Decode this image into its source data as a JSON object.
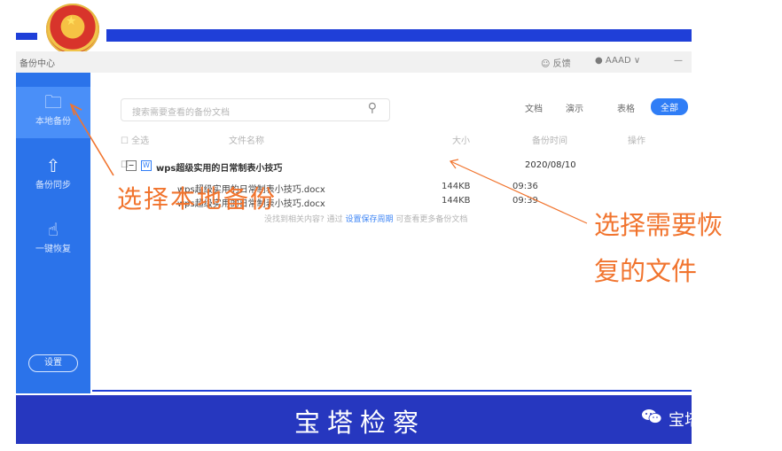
{
  "app": {
    "title": "备份中心",
    "feedback": "反馈",
    "user": "AAAD ∨",
    "minimize": "—"
  },
  "sidebar": {
    "items": [
      {
        "label": "本地备份",
        "icon": "local-backup-icon"
      },
      {
        "label": "备份同步",
        "icon": "cloud-sync-icon"
      },
      {
        "label": "一键恢复",
        "icon": "restore-icon"
      }
    ],
    "settings": "设置"
  },
  "search": {
    "placeholder": "搜索需要查看的备份文档"
  },
  "tabs": [
    "文档",
    "演示",
    "表格",
    "全部"
  ],
  "table": {
    "headers": [
      "全选",
      "文件名称",
      "大小",
      "备份时间",
      "操作"
    ],
    "group": {
      "name": "wps超级实用的日常制表小技巧",
      "date": "2020/08/10"
    },
    "files": [
      {
        "name": "wps超级实用的日常制表小技巧.docx",
        "size": "144KB",
        "time": "09:36"
      },
      {
        "name": "wps超级实用的日常制表小技巧.docx",
        "size": "144KB",
        "time": "09:39"
      }
    ],
    "hint_prefix": "没找到相关内容? 通过",
    "hint_link": "设置保存周期",
    "hint_suffix": "可查看更多备份文档"
  },
  "annotations": {
    "left": "选择本地备份",
    "right_line1": "选择需要恢",
    "right_line2": "复的文件"
  },
  "banner": {
    "title": "宝塔检察",
    "wechat": "宝塔检察"
  },
  "colors": {
    "accent": "#2b73ea",
    "annotation": "#f1742e",
    "banner": "#2637bf"
  }
}
